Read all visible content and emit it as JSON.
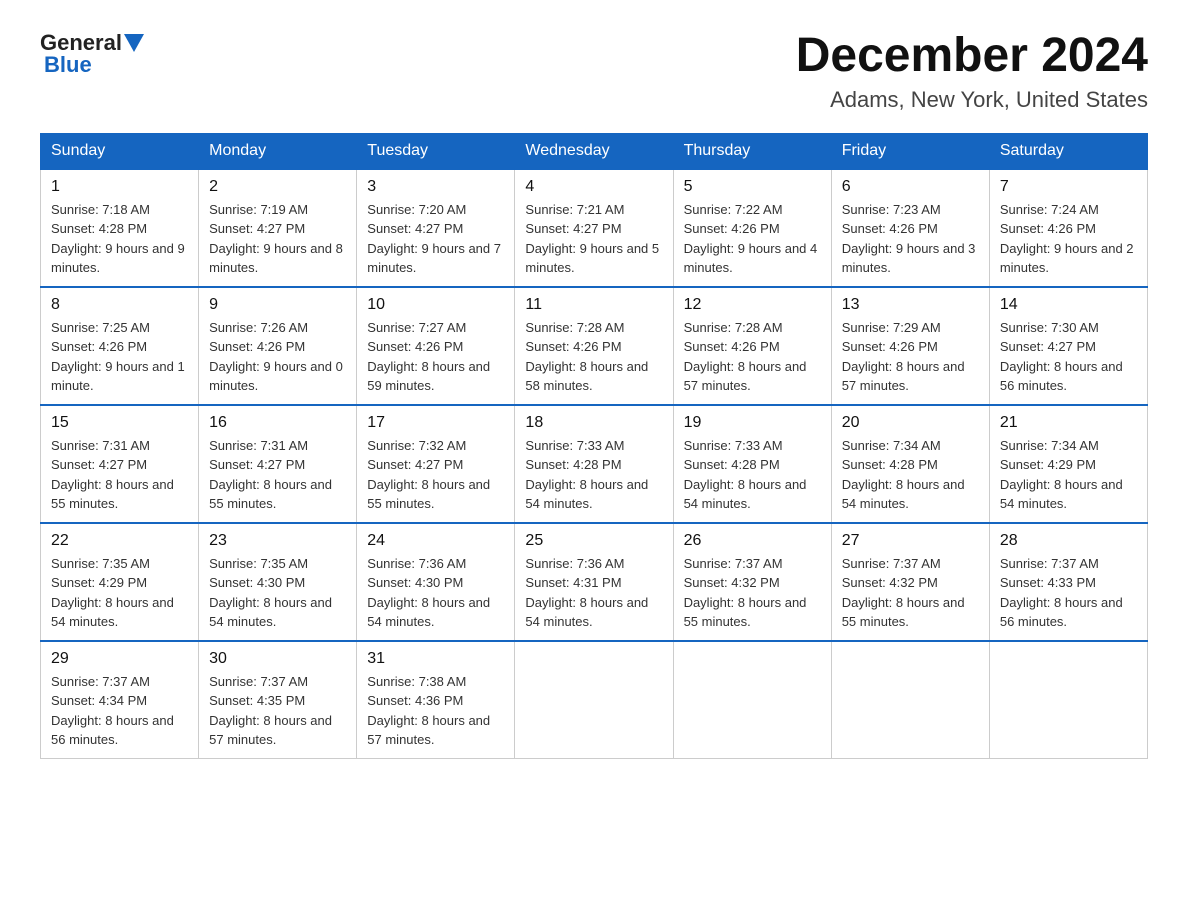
{
  "header": {
    "logo_general": "General",
    "logo_blue": "Blue",
    "title": "December 2024",
    "subtitle": "Adams, New York, United States"
  },
  "days_of_week": [
    "Sunday",
    "Monday",
    "Tuesday",
    "Wednesday",
    "Thursday",
    "Friday",
    "Saturday"
  ],
  "weeks": [
    [
      {
        "num": "1",
        "sunrise": "7:18 AM",
        "sunset": "4:28 PM",
        "daylight": "9 hours and 9 minutes."
      },
      {
        "num": "2",
        "sunrise": "7:19 AM",
        "sunset": "4:27 PM",
        "daylight": "9 hours and 8 minutes."
      },
      {
        "num": "3",
        "sunrise": "7:20 AM",
        "sunset": "4:27 PM",
        "daylight": "9 hours and 7 minutes."
      },
      {
        "num": "4",
        "sunrise": "7:21 AM",
        "sunset": "4:27 PM",
        "daylight": "9 hours and 5 minutes."
      },
      {
        "num": "5",
        "sunrise": "7:22 AM",
        "sunset": "4:26 PM",
        "daylight": "9 hours and 4 minutes."
      },
      {
        "num": "6",
        "sunrise": "7:23 AM",
        "sunset": "4:26 PM",
        "daylight": "9 hours and 3 minutes."
      },
      {
        "num": "7",
        "sunrise": "7:24 AM",
        "sunset": "4:26 PM",
        "daylight": "9 hours and 2 minutes."
      }
    ],
    [
      {
        "num": "8",
        "sunrise": "7:25 AM",
        "sunset": "4:26 PM",
        "daylight": "9 hours and 1 minute."
      },
      {
        "num": "9",
        "sunrise": "7:26 AM",
        "sunset": "4:26 PM",
        "daylight": "9 hours and 0 minutes."
      },
      {
        "num": "10",
        "sunrise": "7:27 AM",
        "sunset": "4:26 PM",
        "daylight": "8 hours and 59 minutes."
      },
      {
        "num": "11",
        "sunrise": "7:28 AM",
        "sunset": "4:26 PM",
        "daylight": "8 hours and 58 minutes."
      },
      {
        "num": "12",
        "sunrise": "7:28 AM",
        "sunset": "4:26 PM",
        "daylight": "8 hours and 57 minutes."
      },
      {
        "num": "13",
        "sunrise": "7:29 AM",
        "sunset": "4:26 PM",
        "daylight": "8 hours and 57 minutes."
      },
      {
        "num": "14",
        "sunrise": "7:30 AM",
        "sunset": "4:27 PM",
        "daylight": "8 hours and 56 minutes."
      }
    ],
    [
      {
        "num": "15",
        "sunrise": "7:31 AM",
        "sunset": "4:27 PM",
        "daylight": "8 hours and 55 minutes."
      },
      {
        "num": "16",
        "sunrise": "7:31 AM",
        "sunset": "4:27 PM",
        "daylight": "8 hours and 55 minutes."
      },
      {
        "num": "17",
        "sunrise": "7:32 AM",
        "sunset": "4:27 PM",
        "daylight": "8 hours and 55 minutes."
      },
      {
        "num": "18",
        "sunrise": "7:33 AM",
        "sunset": "4:28 PM",
        "daylight": "8 hours and 54 minutes."
      },
      {
        "num": "19",
        "sunrise": "7:33 AM",
        "sunset": "4:28 PM",
        "daylight": "8 hours and 54 minutes."
      },
      {
        "num": "20",
        "sunrise": "7:34 AM",
        "sunset": "4:28 PM",
        "daylight": "8 hours and 54 minutes."
      },
      {
        "num": "21",
        "sunrise": "7:34 AM",
        "sunset": "4:29 PM",
        "daylight": "8 hours and 54 minutes."
      }
    ],
    [
      {
        "num": "22",
        "sunrise": "7:35 AM",
        "sunset": "4:29 PM",
        "daylight": "8 hours and 54 minutes."
      },
      {
        "num": "23",
        "sunrise": "7:35 AM",
        "sunset": "4:30 PM",
        "daylight": "8 hours and 54 minutes."
      },
      {
        "num": "24",
        "sunrise": "7:36 AM",
        "sunset": "4:30 PM",
        "daylight": "8 hours and 54 minutes."
      },
      {
        "num": "25",
        "sunrise": "7:36 AM",
        "sunset": "4:31 PM",
        "daylight": "8 hours and 54 minutes."
      },
      {
        "num": "26",
        "sunrise": "7:37 AM",
        "sunset": "4:32 PM",
        "daylight": "8 hours and 55 minutes."
      },
      {
        "num": "27",
        "sunrise": "7:37 AM",
        "sunset": "4:32 PM",
        "daylight": "8 hours and 55 minutes."
      },
      {
        "num": "28",
        "sunrise": "7:37 AM",
        "sunset": "4:33 PM",
        "daylight": "8 hours and 56 minutes."
      }
    ],
    [
      {
        "num": "29",
        "sunrise": "7:37 AM",
        "sunset": "4:34 PM",
        "daylight": "8 hours and 56 minutes."
      },
      {
        "num": "30",
        "sunrise": "7:37 AM",
        "sunset": "4:35 PM",
        "daylight": "8 hours and 57 minutes."
      },
      {
        "num": "31",
        "sunrise": "7:38 AM",
        "sunset": "4:36 PM",
        "daylight": "8 hours and 57 minutes."
      },
      null,
      null,
      null,
      null
    ]
  ]
}
